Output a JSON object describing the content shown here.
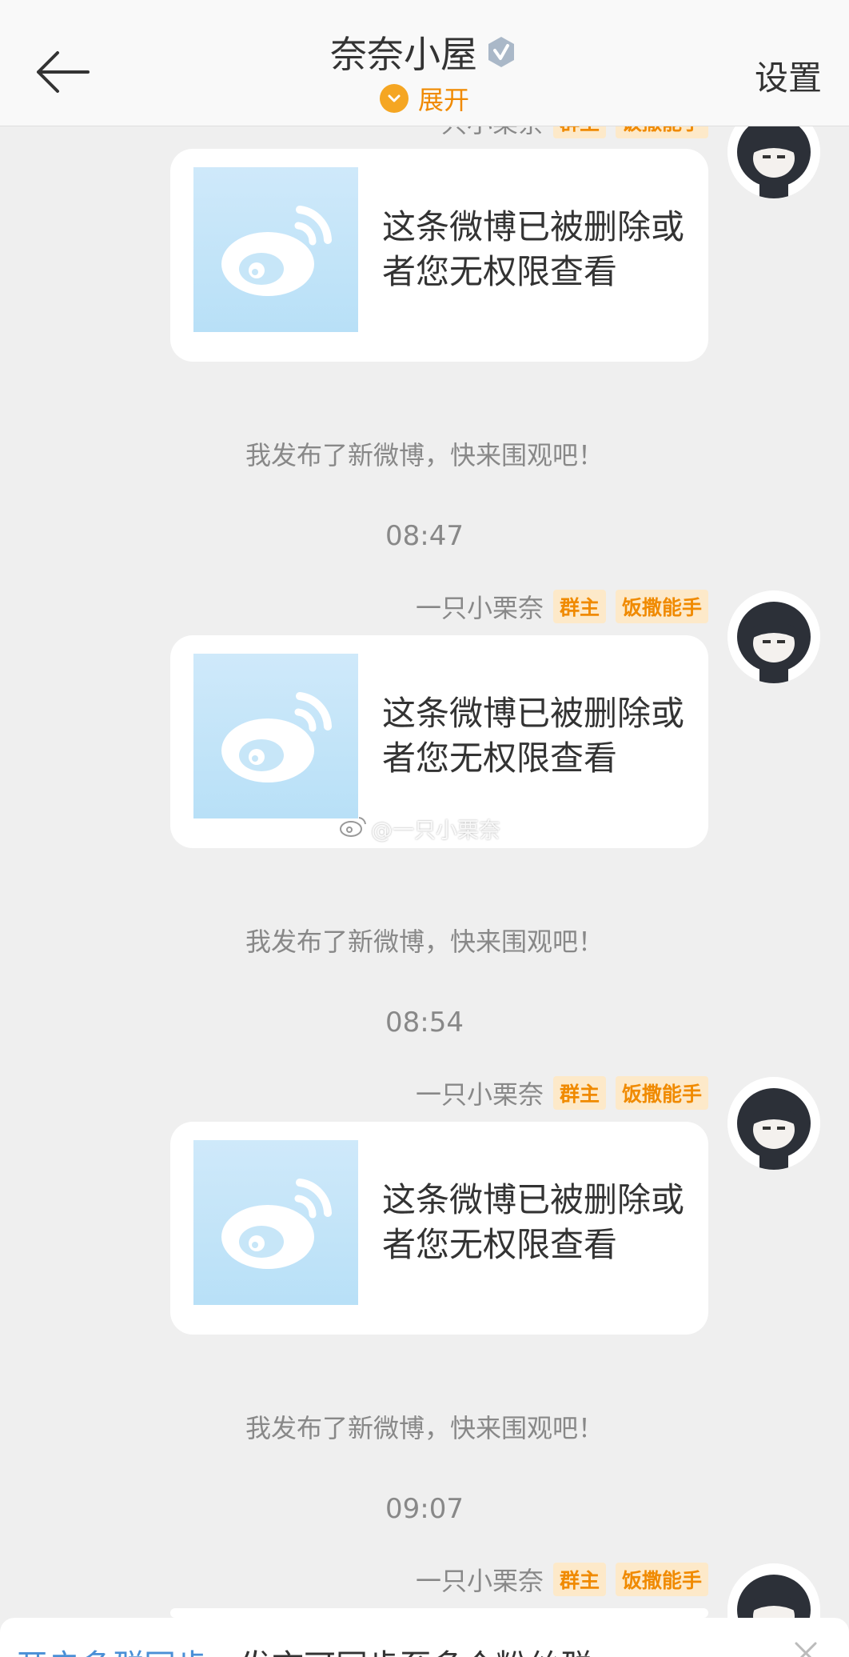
{
  "header": {
    "title": "奈奈小屋",
    "expand_label": "展开",
    "settings_label": "设置"
  },
  "messages": [
    {
      "sender": "一只小栗奈",
      "badges": [
        "群主",
        "饭撒能手"
      ],
      "deleted_text": "这条微博已被删除或者您无权限查看"
    },
    {
      "system_text": "我发布了新微博，快来围观吧！",
      "time": "08:47",
      "sender": "一只小栗奈",
      "badges": [
        "群主",
        "饭撒能手"
      ],
      "deleted_text": "这条微博已被删除或者您无权限查看"
    },
    {
      "system_text": "我发布了新微博，快来围观吧！",
      "time": "08:54",
      "sender": "一只小栗奈",
      "badges": [
        "群主",
        "饭撒能手"
      ],
      "deleted_text": "这条微博已被删除或者您无权限查看"
    },
    {
      "system_text": "我发布了新微博，快来围观吧！",
      "time": "09:07",
      "sender": "一只小栗奈",
      "badges": [
        "群主",
        "饭撒能手"
      ]
    }
  ],
  "watermark": "@一只小栗奈",
  "bottom_bar": {
    "link_text": "开启多群同步",
    "text": "发言可同步至多个粉丝群"
  },
  "colors": {
    "accent": "#f08a00",
    "badge_bg": "#fde9c9",
    "link": "#4a8fd6",
    "background": "#efefef"
  }
}
